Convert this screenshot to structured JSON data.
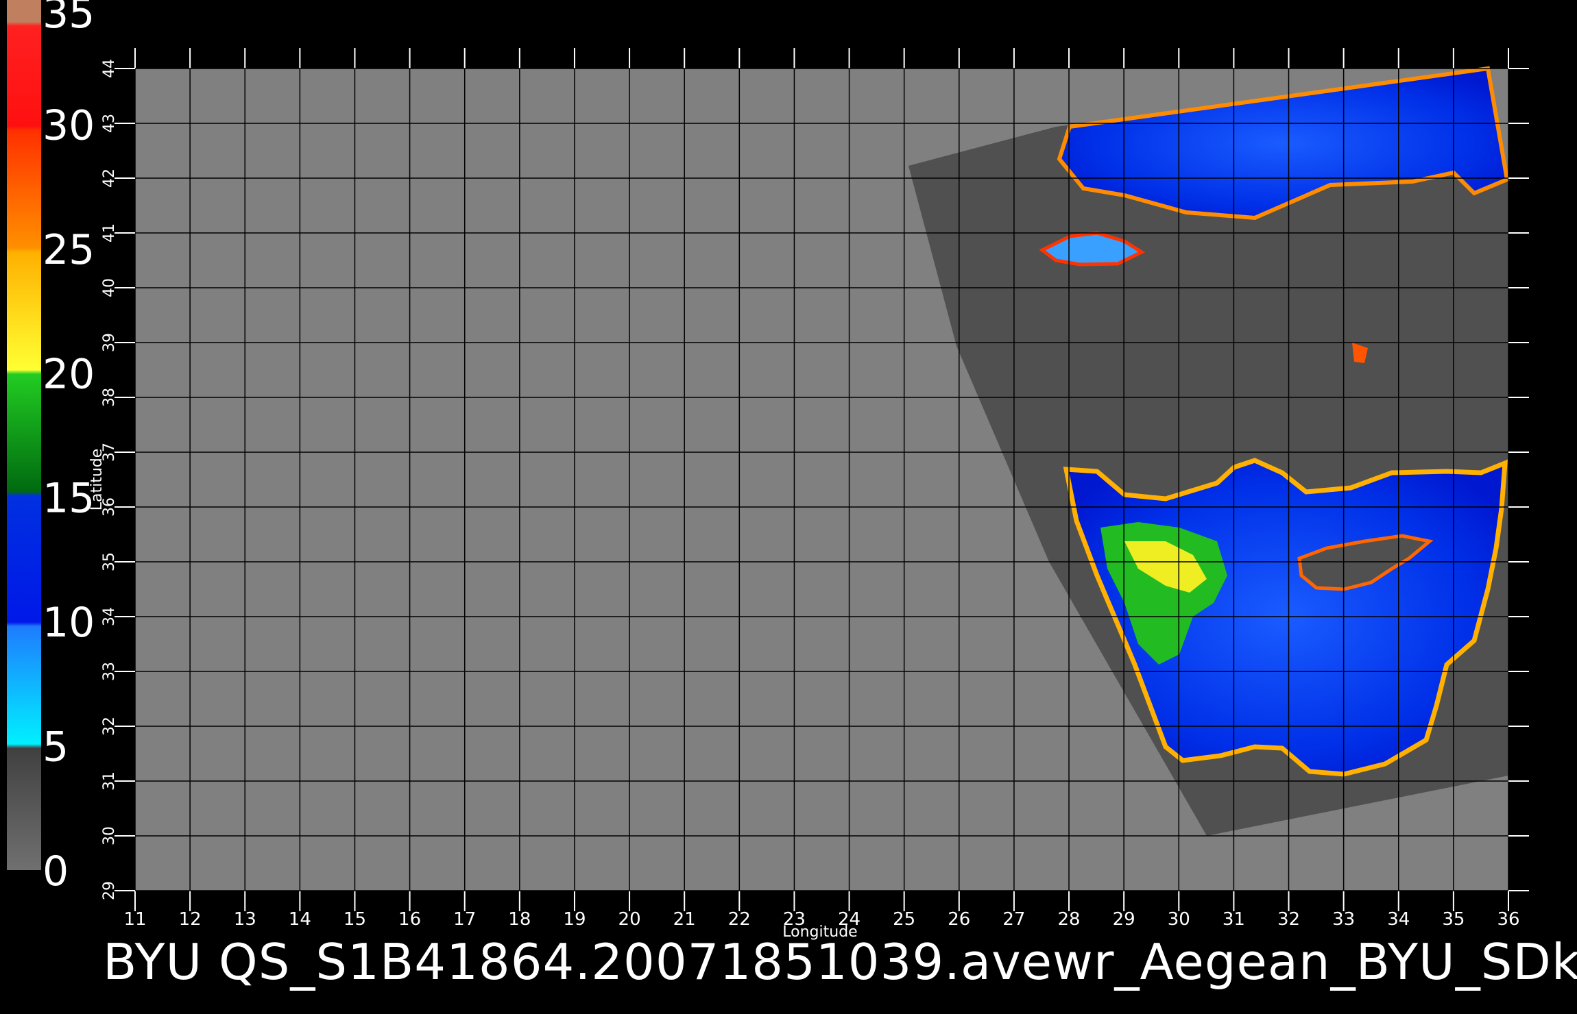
{
  "title": "BYU QS_S1B41864.20071851039.avewr_Aegean_BYU_SDk",
  "map": {
    "xlabel": "Longitude",
    "ylabel": "Latitude",
    "lon_range": [
      11,
      36
    ],
    "lat_range": [
      29,
      44
    ],
    "lon_ticks": [
      "11",
      "12",
      "13",
      "14",
      "15",
      "16",
      "17",
      "18",
      "19",
      "20",
      "21",
      "22",
      "23",
      "24",
      "25",
      "26",
      "27",
      "28",
      "29",
      "30",
      "31",
      "32",
      "33",
      "34",
      "35",
      "36"
    ],
    "lat_ticks": [
      "29",
      "30",
      "31",
      "32",
      "33",
      "34",
      "35",
      "36",
      "37",
      "38",
      "39",
      "40",
      "41",
      "42",
      "43",
      "44"
    ],
    "grid": true
  },
  "colorbar": {
    "labels": [
      "0",
      "5",
      "10",
      "15",
      "20",
      "25",
      "30",
      "35"
    ],
    "range": [
      0,
      35
    ],
    "stops": [
      {
        "from": 0,
        "to": 5,
        "color": "#606060"
      },
      {
        "from": 5,
        "to": 10,
        "color": "#2299ff"
      },
      {
        "from": 10,
        "to": 15,
        "color": "#0022ee"
      },
      {
        "from": 15,
        "to": 20,
        "color": "#11aa11"
      },
      {
        "from": 20,
        "to": 25,
        "color": "#ffd400"
      },
      {
        "from": 25,
        "to": 30,
        "color": "#ff6a00"
      },
      {
        "from": 30,
        "to": 35,
        "color": "#ff1a1a"
      }
    ]
  },
  "colors": {
    "background": "#000000",
    "plot_area": "#808080",
    "swath": "#505050",
    "grid": "#000000"
  }
}
